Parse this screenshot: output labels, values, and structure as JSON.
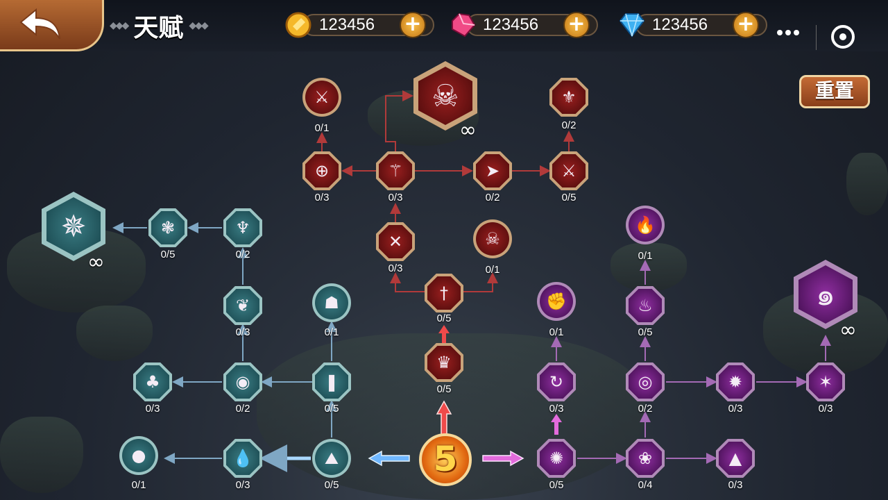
{
  "title": {
    "text": "天赋",
    "dots_left": "◆◆◆",
    "dots_right": "◆◆◆"
  },
  "currencies": [
    {
      "name": "gold",
      "value": "123456",
      "icon": "gold-coin-icon"
    },
    {
      "name": "ruby",
      "value": "123456",
      "icon": "ruby-gem-icon"
    },
    {
      "name": "diamond",
      "value": "123456",
      "icon": "blue-diamond-icon"
    }
  ],
  "plus_symbol": "+",
  "reset_label": "重置",
  "center_level": "5",
  "infinity": "∞",
  "colors": {
    "teal": "#3a7c83",
    "red": "#9a1f1f",
    "purple": "#8f2ea0",
    "gold": "#f1d28f",
    "link_teal": "#7fa7c4",
    "link_red": "#b13a3a",
    "link_purple": "#a46ab5"
  },
  "nodes": {
    "t_base": {
      "label": "0/5",
      "icon": "golem-icon",
      "tree": "teal"
    },
    "t_drop": {
      "label": "0/3",
      "icon": "water-drop-icon",
      "tree": "teal"
    },
    "t_orb": {
      "label": "0/1",
      "icon": "orb-icon",
      "tree": "teal"
    },
    "t_crystal": {
      "label": "0/5",
      "icon": "crystal-icon",
      "tree": "teal"
    },
    "t_eye": {
      "label": "0/2",
      "icon": "eye-icon",
      "tree": "teal"
    },
    "t_clover": {
      "label": "0/3",
      "icon": "clover-icon",
      "tree": "teal"
    },
    "t_hood": {
      "label": "0/1",
      "icon": "hooded-figure-icon",
      "tree": "teal"
    },
    "t_spirit": {
      "label": "0/3",
      "icon": "spirit-icon",
      "tree": "teal"
    },
    "t_mask": {
      "label": "0/2",
      "icon": "winged-mask-icon",
      "tree": "teal"
    },
    "t_wings": {
      "label": "0/5",
      "icon": "wings-icon",
      "tree": "teal"
    },
    "t_phoenix": {
      "label": "∞",
      "icon": "phoenix-icon",
      "tree": "teal"
    },
    "r_crown": {
      "label": "0/5",
      "icon": "crown-icon",
      "tree": "red"
    },
    "r_sword": {
      "label": "0/5",
      "icon": "sword-icon",
      "tree": "red"
    },
    "r_cross": {
      "label": "0/3",
      "icon": "crossed-swords-icon",
      "tree": "red"
    },
    "r_poison": {
      "label": "0/1",
      "icon": "poison-skull-icon",
      "tree": "red"
    },
    "r_claw": {
      "label": "0/3",
      "icon": "claw-icon",
      "tree": "red"
    },
    "r_target": {
      "label": "0/3",
      "icon": "crosshair-icon",
      "tree": "red"
    },
    "r_spike": {
      "label": "0/1",
      "icon": "spikes-icon",
      "tree": "red"
    },
    "r_skull": {
      "label": "∞",
      "icon": "skull-icon",
      "tree": "red"
    },
    "r_dash": {
      "label": "0/2",
      "icon": "dash-arrow-icon",
      "tree": "red"
    },
    "r_blades": {
      "label": "0/5",
      "icon": "crossed-blades-icon",
      "tree": "red"
    },
    "r_fleur": {
      "label": "0/2",
      "icon": "fleur-icon",
      "tree": "red"
    },
    "p_swirl": {
      "label": "0/5",
      "icon": "swirl-icon",
      "tree": "purple"
    },
    "p_lotus": {
      "label": "0/4",
      "icon": "lotus-icon",
      "tree": "purple"
    },
    "p_assassin": {
      "label": "0/3",
      "icon": "assassin-icon",
      "tree": "purple"
    },
    "p_cycle": {
      "label": "0/3",
      "icon": "cycle-icon",
      "tree": "purple"
    },
    "p_fist": {
      "label": "0/1",
      "icon": "fist-icon",
      "tree": "purple"
    },
    "p_ring": {
      "label": "0/2",
      "icon": "fire-ring-icon",
      "tree": "purple"
    },
    "p_vortex": {
      "label": "0/3",
      "icon": "vortex-icon",
      "tree": "purple"
    },
    "p_dragon": {
      "label": "0/3",
      "icon": "dragon-icon",
      "tree": "purple"
    },
    "p_flameA": {
      "label": "0/5",
      "icon": "flame-icon",
      "tree": "purple"
    },
    "p_flameB": {
      "label": "0/1",
      "icon": "big-flame-icon",
      "tree": "purple"
    },
    "p_spiral": {
      "label": "∞",
      "icon": "spiral-icon",
      "tree": "purple"
    }
  }
}
